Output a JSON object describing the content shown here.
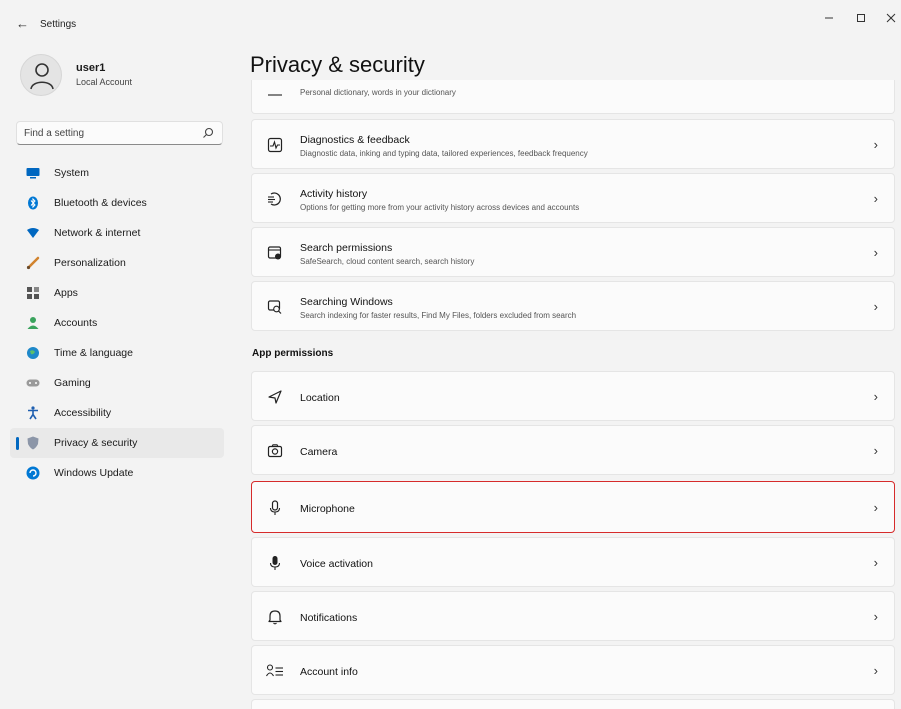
{
  "window": {
    "title": "Settings"
  },
  "user": {
    "name": "user1",
    "account_type": "Local Account"
  },
  "search": {
    "placeholder": "Find a setting"
  },
  "nav": [
    {
      "label": "System",
      "icon": "monitor-icon",
      "color": "#0067c0",
      "active": false
    },
    {
      "label": "Bluetooth & devices",
      "icon": "bluetooth-icon",
      "color": "#0078d4",
      "active": false
    },
    {
      "label": "Network & internet",
      "icon": "wifi-icon",
      "color": "#0067c0",
      "active": false
    },
    {
      "label": "Personalization",
      "icon": "brush-icon",
      "color": "#d1832e",
      "active": false
    },
    {
      "label": "Apps",
      "icon": "apps-icon",
      "color": "#444444",
      "active": false
    },
    {
      "label": "Accounts",
      "icon": "person-icon",
      "color": "#3aa35d",
      "active": false
    },
    {
      "label": "Time & language",
      "icon": "globe-icon",
      "color": "#1e88c9",
      "active": false
    },
    {
      "label": "Gaming",
      "icon": "controller-icon",
      "color": "#8a8a8a",
      "active": false
    },
    {
      "label": "Accessibility",
      "icon": "accessibility-icon",
      "color": "#1f5fb0",
      "active": false
    },
    {
      "label": "Privacy & security",
      "icon": "shield-icon",
      "color": "#8c96a8",
      "active": true
    },
    {
      "label": "Windows Update",
      "icon": "update-icon",
      "color": "#0078d4",
      "active": false
    }
  ],
  "main": {
    "title": "Privacy & security",
    "partial_card_sub": "Personal dictionary, words in your dictionary",
    "cards": [
      {
        "title": "Diagnostics & feedback",
        "subtitle": "Diagnostic data, inking and typing data, tailored experiences, feedback frequency",
        "icon": "diagnostics-icon"
      },
      {
        "title": "Activity history",
        "subtitle": "Options for getting more from your activity history across devices and accounts",
        "icon": "activity-history-icon"
      },
      {
        "title": "Search permissions",
        "subtitle": "SafeSearch, cloud content search, search history",
        "icon": "search-permissions-icon"
      },
      {
        "title": "Searching Windows",
        "subtitle": "Search indexing for faster results, Find My Files, folders excluded from search",
        "icon": "searching-windows-icon"
      }
    ],
    "section_header": "App permissions",
    "permissions": [
      {
        "title": "Location",
        "icon": "location-icon",
        "highlighted": false
      },
      {
        "title": "Camera",
        "icon": "camera-icon",
        "highlighted": false
      },
      {
        "title": "Microphone",
        "icon": "microphone-icon",
        "highlighted": true
      },
      {
        "title": "Voice activation",
        "icon": "voice-activation-icon",
        "highlighted": false
      },
      {
        "title": "Notifications",
        "icon": "bell-icon",
        "highlighted": false
      },
      {
        "title": "Account info",
        "icon": "account-info-icon",
        "highlighted": false
      }
    ],
    "highlight_color": "#d62b2b"
  }
}
